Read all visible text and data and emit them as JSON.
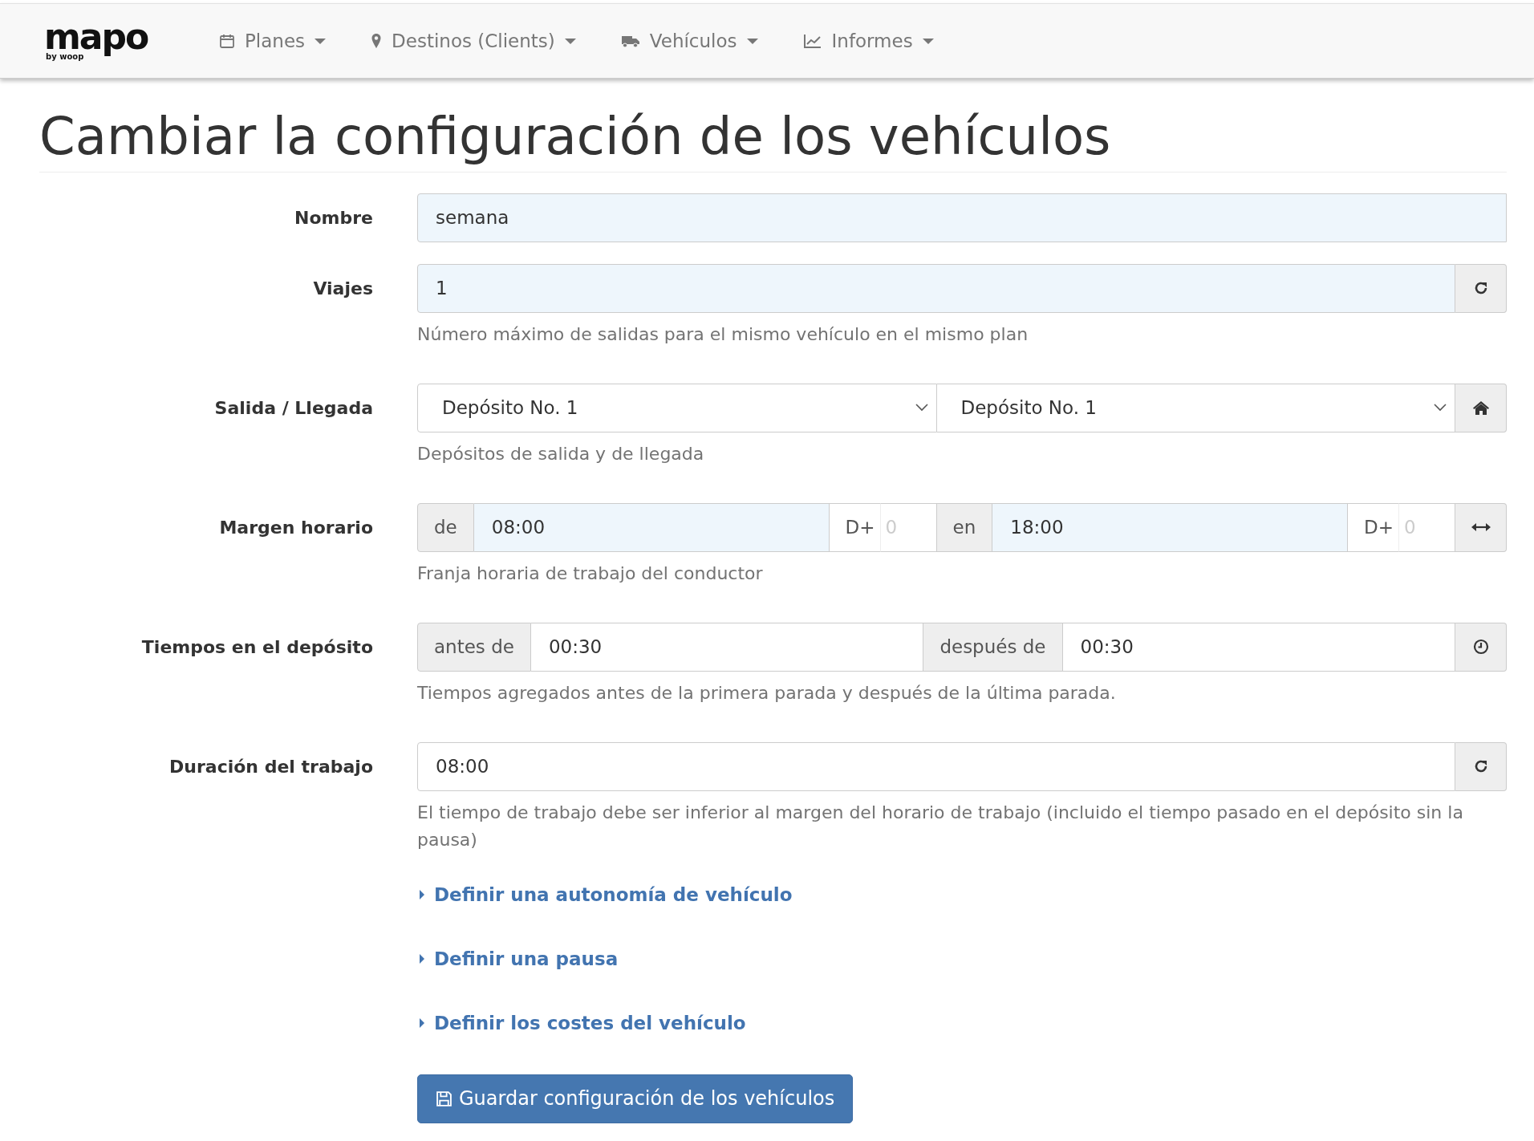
{
  "navbar": {
    "logo": {
      "text": "mapo",
      "sub": "by woop"
    },
    "menu": [
      {
        "label": "Planes"
      },
      {
        "label": "Destinos (Clients)"
      },
      {
        "label": "Vehículos"
      },
      {
        "label": "Informes"
      }
    ]
  },
  "title": "Cambiar la configuración de los vehículos",
  "fields": [
    {
      "kind": "text",
      "label": "Nombre",
      "value": "semana",
      "autofilled": true
    },
    {
      "kind": "text-reset",
      "label": "Viajes",
      "value": "1",
      "autofilled": true,
      "help": "Número máximo de salidas para el mismo vehículo en el mismo plan"
    },
    {
      "kind": "select-pair",
      "label": "Salida / Llegada",
      "selects": [
        {
          "value": "Depósito No. 1"
        },
        {
          "value": "Depósito No. 1"
        }
      ],
      "help": "Depósitos de salida y de llegada"
    },
    {
      "kind": "time-range",
      "label": "Margen horario",
      "segments": [
        {
          "prefix": "de",
          "value": "08:00",
          "autofilled": true,
          "day_prefix": "D+",
          "day_placeholder": "0"
        },
        {
          "prefix": "en",
          "value": "18:00",
          "autofilled": true,
          "day_prefix": "D+",
          "day_placeholder": "0"
        }
      ],
      "help": "Franja horaria de trabajo del conductor"
    },
    {
      "kind": "depot-times",
      "label": "Tiempos en el depósito",
      "segments": [
        {
          "prefix": "antes de",
          "value": "00:30",
          "autofilled": false
        },
        {
          "prefix": "después de",
          "value": "00:30",
          "autofilled": false
        }
      ],
      "help": "Tiempos agregados antes de la primera parada y después de la última parada."
    },
    {
      "kind": "text-reset",
      "label": "Duración del trabajo",
      "value": "08:00",
      "autofilled": false,
      "help": "El tiempo de trabajo debe ser inferior al margen del horario de trabajo (incluido el tiempo pasado en el depósito sin la pausa)"
    }
  ],
  "sections": [
    {
      "label": "Definir una autonomía de vehículo",
      "expanded": false
    },
    {
      "label": "Definir una pausa",
      "expanded": false
    },
    {
      "label": "Definir los costes del vehículo",
      "expanded": false
    }
  ],
  "save_button": {
    "label": "Guardar configuración de los vehículos"
  }
}
